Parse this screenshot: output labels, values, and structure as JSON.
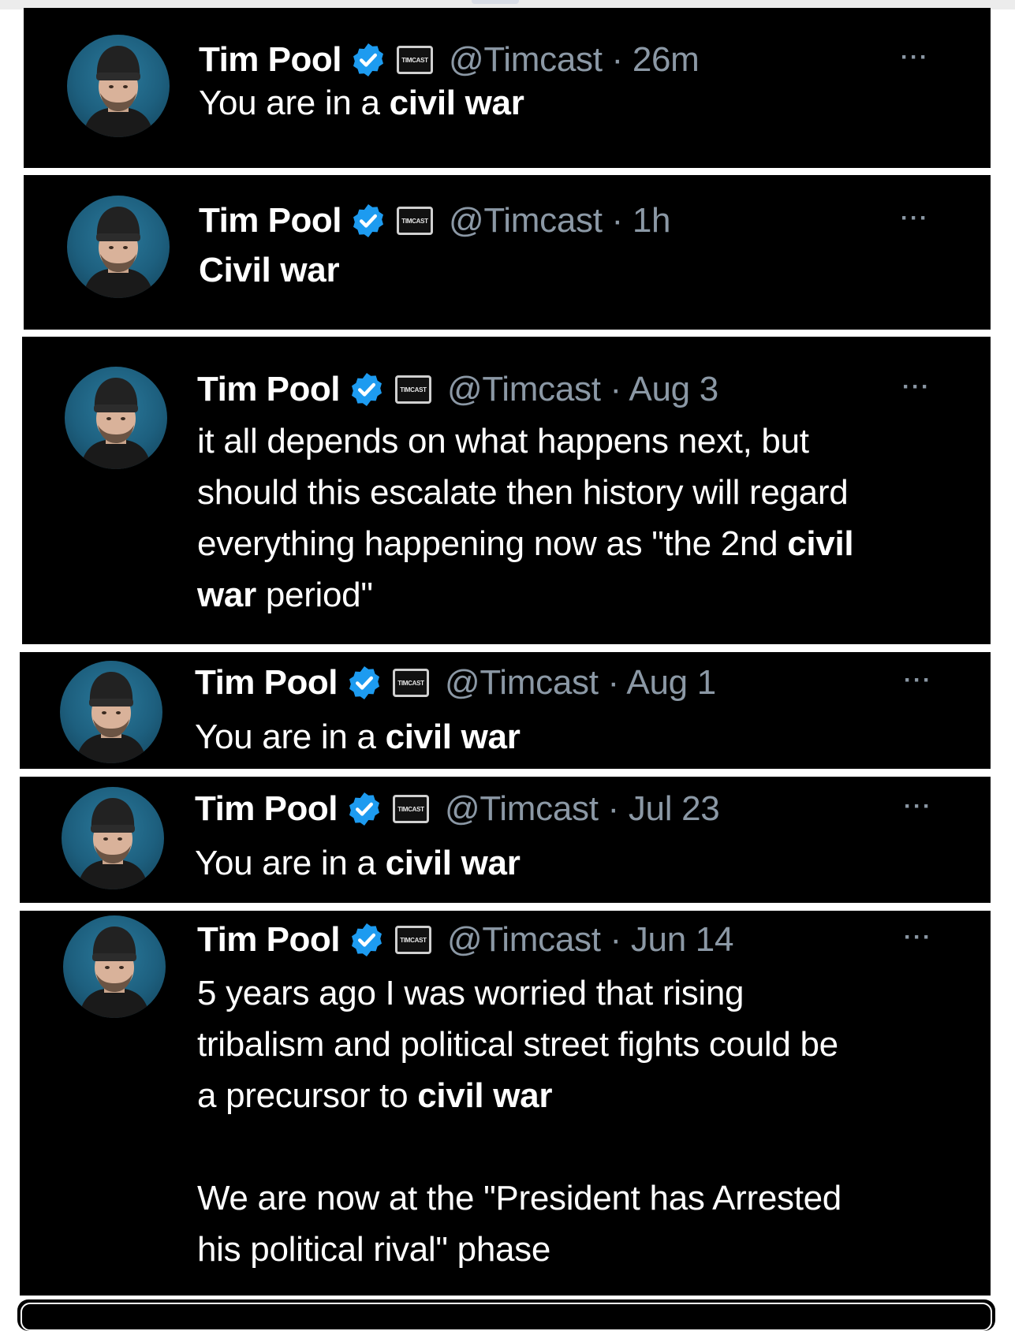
{
  "colors": {
    "background": "#ffffff",
    "card": "#000000",
    "name": "#ffffff",
    "handle": "#8b98a5",
    "verified": "#1d9bf0"
  },
  "icons": {
    "verified": "verified-badge-icon",
    "affiliate": "timcast-affiliate-icon",
    "more": "more-options-icon",
    "avatar": "avatar"
  },
  "tweets": [
    {
      "name": "Tim Pool",
      "affiliate": "TIMCAST",
      "handle_line": "@Timcast · 26m",
      "more": "···",
      "paragraphs": [
        [
          [
            {
              "t": "You are in a ",
              "b": false
            },
            {
              "t": "civil war",
              "b": true
            }
          ]
        ]
      ]
    },
    {
      "name": "Tim Pool",
      "affiliate": "TIMCAST",
      "handle_line": "@Timcast · 1h",
      "more": "···",
      "paragraphs": [
        [
          [
            {
              "t": "Civil war",
              "b": true
            }
          ]
        ]
      ]
    },
    {
      "name": "Tim Pool",
      "affiliate": "TIMCAST",
      "handle_line": "@Timcast · Aug 3",
      "more": "···",
      "paragraphs": [
        [
          [
            {
              "t": "it all depends on what happens next, but",
              "b": false
            }
          ],
          [
            {
              "t": "should this escalate then history will regard",
              "b": false
            }
          ],
          [
            {
              "t": "everything happening now as \"the 2nd ",
              "b": false
            },
            {
              "t": "civil",
              "b": true
            }
          ],
          [
            {
              "t": "war",
              "b": true
            },
            {
              "t": " period\"",
              "b": false
            }
          ]
        ]
      ]
    },
    {
      "name": "Tim Pool",
      "affiliate": "TIMCAST",
      "handle_line": "@Timcast · Aug 1",
      "more": "···",
      "paragraphs": [
        [
          [
            {
              "t": "You are in a ",
              "b": false
            },
            {
              "t": "civil war",
              "b": true
            }
          ]
        ]
      ]
    },
    {
      "name": "Tim Pool",
      "affiliate": "TIMCAST",
      "handle_line": "@Timcast · Jul 23",
      "more": "···",
      "paragraphs": [
        [
          [
            {
              "t": "You are in a ",
              "b": false
            },
            {
              "t": "civil war",
              "b": true
            }
          ]
        ]
      ]
    },
    {
      "name": "Tim Pool",
      "affiliate": "TIMCAST",
      "handle_line": "@Timcast · Jun 14",
      "more": "···",
      "paragraphs": [
        [
          [
            {
              "t": "5 years ago I was worried that rising",
              "b": false
            }
          ],
          [
            {
              "t": "tribalism and political street fights could be",
              "b": false
            }
          ],
          [
            {
              "t": "a precursor to ",
              "b": false
            },
            {
              "t": "civil war",
              "b": true
            }
          ]
        ],
        [
          [
            {
              "t": "We are now at the \"President has Arrested",
              "b": false
            }
          ],
          [
            {
              "t": "his political rival\" phase",
              "b": false
            }
          ]
        ]
      ]
    }
  ]
}
